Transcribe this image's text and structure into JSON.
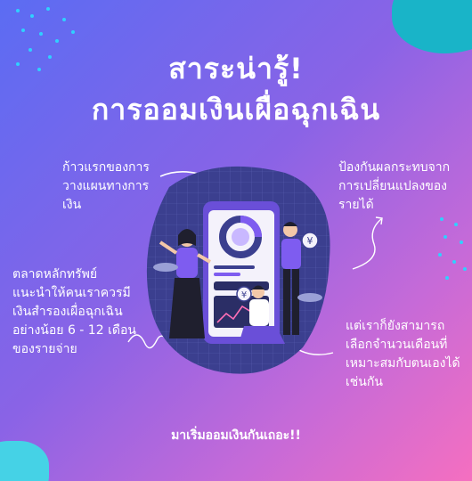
{
  "title": {
    "line1": "สาระน่ารู้!",
    "line2": "การออมเงินเผื่อฉุกเฉิน"
  },
  "blurbs": {
    "top_left": "ก้าวแรกของการ\nวางแผนทางการ\nเงิน",
    "top_right": "ป้องกันผลกระทบจาก\nการเปลี่ยนแปลงของ\nรายได้",
    "mid_left": "ตลาดหลักทรัพย์\nแนะนำให้คนเราควรมี\nเงินสำรองเผื่อฉุกเฉิน\nอย่างน้อย 6 - 12 เดือน\nของรายจ่าย",
    "bottom_right": "แต่เราก็ยังสามารถ\nเลือกจำนวนเดือนที่\nเหมาะสมกับตนเองได้\nเช่นกัน"
  },
  "cta": "มาเริ่มออมเงินกันเถอะ!!",
  "illustration": {
    "coin_symbol": "¥"
  },
  "colors": {
    "accent_cyan": "#19b4c8",
    "blob_navy": "#3b3f8f",
    "phone_purple": "#6a4fd8"
  }
}
